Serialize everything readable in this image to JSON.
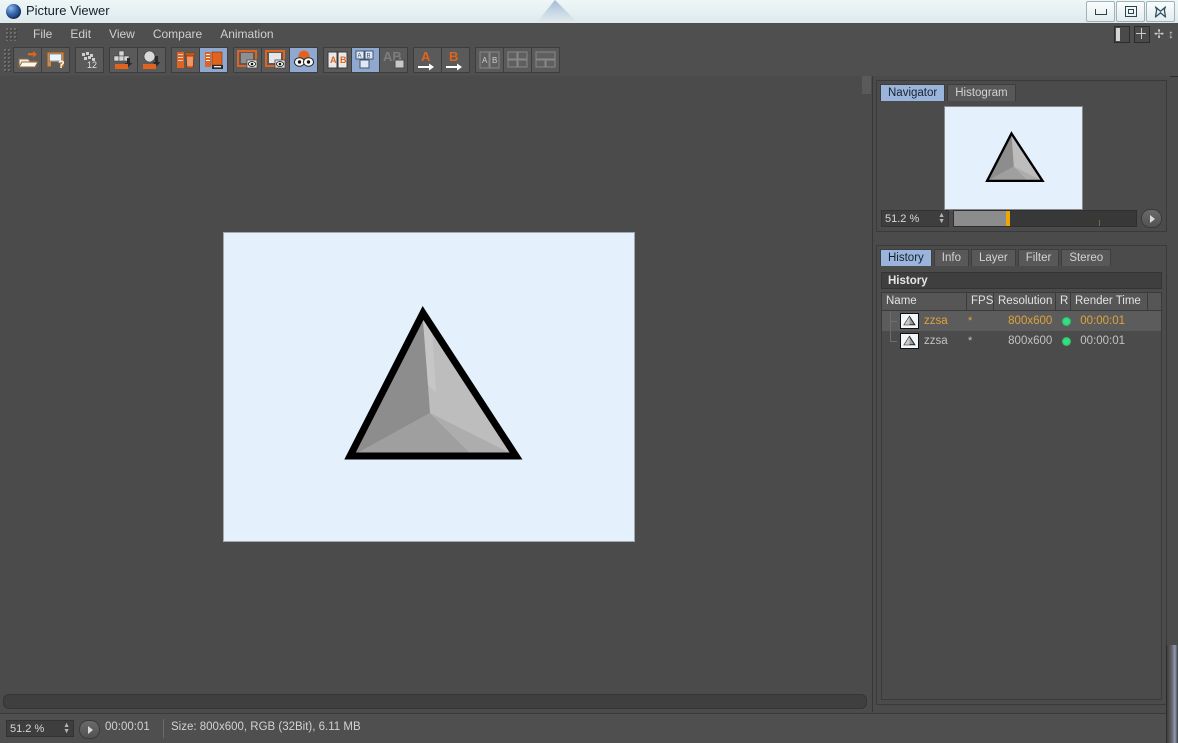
{
  "window": {
    "title": "Picture Viewer",
    "logo_icon": "app-sphere-icon",
    "controls": [
      {
        "name": "minimize",
        "glyph": "minimize-icon"
      },
      {
        "name": "restore",
        "glyph": "restore-icon"
      },
      {
        "name": "close",
        "glyph": "close-icon"
      }
    ]
  },
  "menubar": {
    "grip_icon": "drag-grip-icon",
    "items": [
      {
        "label": "File"
      },
      {
        "label": "Edit"
      },
      {
        "label": "View"
      },
      {
        "label": "Compare"
      },
      {
        "label": "Animation"
      }
    ],
    "right_icons": [
      {
        "name": "split-view-icon"
      },
      {
        "name": "add-view-icon"
      },
      {
        "name": "move-icon"
      },
      {
        "name": "dock-arrows-icon"
      }
    ]
  },
  "toolbar": {
    "grip_icon": "toolbar-grip-icon",
    "groups": [
      {
        "buttons": [
          {
            "name": "open-image-button",
            "icon": "folder-open-icon",
            "selected": false
          },
          {
            "name": "save-image-button",
            "icon": "save-question-icon",
            "selected": false
          }
        ]
      },
      {
        "buttons": [
          {
            "name": "render-settings-button",
            "icon": "film-12-icon",
            "selected": false
          }
        ]
      },
      {
        "buttons": [
          {
            "name": "load-frames-button",
            "icon": "frames-down-icon",
            "selected": false
          },
          {
            "name": "load-single-button",
            "icon": "sphere-down-icon",
            "selected": false
          }
        ]
      },
      {
        "buttons": [
          {
            "name": "delete-entry-button",
            "icon": "trash-icon",
            "selected": false
          },
          {
            "name": "duplicate-entry-button",
            "icon": "copy-entry-icon",
            "selected": true
          }
        ]
      },
      {
        "buttons": [
          {
            "name": "view-a-button",
            "icon": "frame-a-eye-icon",
            "selected": false
          },
          {
            "name": "view-b-button",
            "icon": "frame-b-eye-icon",
            "selected": false
          },
          {
            "name": "view-ab-button",
            "icon": "eyes-ab-icon",
            "selected": true
          }
        ]
      },
      {
        "buttons": [
          {
            "name": "compare-ab-button",
            "icon": "ab-side-icon",
            "selected": false
          },
          {
            "name": "compare-ab-diff-button",
            "icon": "ab-diff-icon",
            "selected": true
          },
          {
            "name": "compare-ab-blend-button",
            "icon": "ab-blend-icon",
            "selected": false
          }
        ]
      },
      {
        "buttons": [
          {
            "name": "set-a-button",
            "icon": "a-arrow-icon",
            "selected": false
          },
          {
            "name": "set-b-button",
            "icon": "b-arrow-icon",
            "selected": false
          }
        ]
      },
      {
        "buttons": [
          {
            "name": "layout-split-button",
            "icon": "layout-ab-icon",
            "selected": false
          },
          {
            "name": "layout-quad-button",
            "icon": "layout-quad-icon",
            "selected": false
          },
          {
            "name": "layout-stack-button",
            "icon": "layout-stack-icon",
            "selected": false
          }
        ]
      }
    ]
  },
  "canvas": {
    "image_background": "#e4f0fb",
    "scrollbar_horizontal": "canvas-hscroll"
  },
  "navigator": {
    "tabs": [
      {
        "label": "Navigator",
        "active": true
      },
      {
        "label": "Histogram",
        "active": false
      }
    ],
    "zoom_value": "51.2 %",
    "play_icon": "play-icon"
  },
  "history_panel": {
    "tabs": [
      {
        "label": "History",
        "active": true
      },
      {
        "label": "Info",
        "active": false
      },
      {
        "label": "Layer",
        "active": false
      },
      {
        "label": "Filter",
        "active": false
      },
      {
        "label": "Stereo",
        "active": false
      }
    ],
    "section_title": "History",
    "columns": [
      {
        "label": "Name"
      },
      {
        "label": "FPS"
      },
      {
        "label": "Resolution"
      },
      {
        "label": "R"
      },
      {
        "label": "Render Time"
      },
      {
        "label": ""
      }
    ],
    "rows": [
      {
        "thumb_icon": "pyramid-thumb-icon",
        "name": "zzsa",
        "star": "*",
        "fps": "",
        "resolution": "800x600",
        "status_color": "#36e07f",
        "render_time": "00:00:01",
        "selected": true
      },
      {
        "thumb_icon": "pyramid-thumb-icon",
        "name": "zzsa",
        "star": "*",
        "fps": "",
        "resolution": "800x600",
        "status_color": "#36e07f",
        "render_time": "00:00:01",
        "selected": false
      }
    ]
  },
  "statusbar": {
    "zoom_value": "51.2 %",
    "play_icon": "play-icon",
    "time": "00:00:01",
    "size_info": "Size: 800x600, RGB (32Bit), 6.11 MB"
  },
  "colors": {
    "accent_orange": "#e0a33a",
    "selection_blue": "#9bb4dc",
    "status_green": "#36e07f",
    "panel_bg": "#4b4b4b",
    "image_bg": "#e4f0fb"
  }
}
